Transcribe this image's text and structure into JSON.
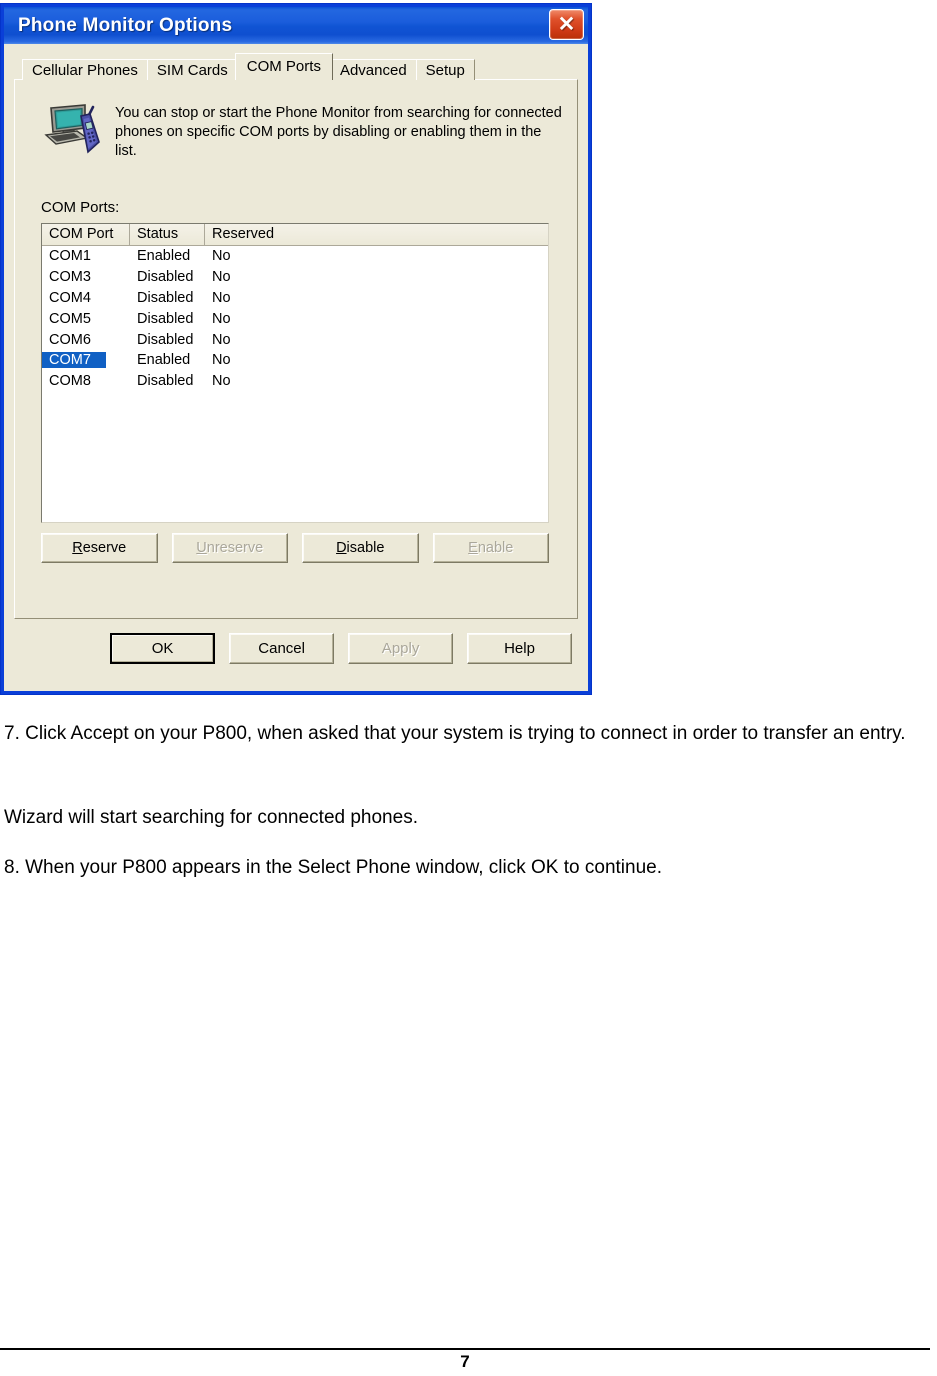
{
  "dialog": {
    "title": "Phone Monitor Options",
    "close_label": "✕",
    "tabs": [
      {
        "label": "Cellular Phones",
        "active": false
      },
      {
        "label": "SIM Cards",
        "active": false
      },
      {
        "label": "COM Ports",
        "active": true
      },
      {
        "label": "Advanced",
        "active": false
      },
      {
        "label": "Setup",
        "active": false
      }
    ],
    "info_text": "You can stop or start the Phone Monitor from searching for connected phones on specific COM ports by disabling or enabling them in the list.",
    "section_label": "COM Ports:",
    "listview": {
      "columns": [
        "COM Port",
        "Status",
        "Reserved"
      ],
      "rows": [
        {
          "port": "COM1",
          "status": "Enabled",
          "reserved": "No",
          "selected": false
        },
        {
          "port": "COM3",
          "status": "Disabled",
          "reserved": "No",
          "selected": false
        },
        {
          "port": "COM4",
          "status": "Disabled",
          "reserved": "No",
          "selected": false
        },
        {
          "port": "COM5",
          "status": "Disabled",
          "reserved": "No",
          "selected": false
        },
        {
          "port": "COM6",
          "status": "Disabled",
          "reserved": "No",
          "selected": false
        },
        {
          "port": "COM7",
          "status": "Enabled",
          "reserved": "No",
          "selected": true
        },
        {
          "port": "COM8",
          "status": "Disabled",
          "reserved": "No",
          "selected": false
        }
      ]
    },
    "action_buttons": [
      {
        "label": "Reserve",
        "accel": "R",
        "enabled": true
      },
      {
        "label": "Unreserve",
        "accel": "U",
        "enabled": false
      },
      {
        "label": "Disable",
        "accel": "D",
        "enabled": true
      },
      {
        "label": "Enable",
        "accel": "E",
        "enabled": false
      }
    ],
    "footer_buttons": [
      {
        "label": "OK",
        "accel": "O",
        "enabled": true,
        "default": true
      },
      {
        "label": "Cancel",
        "accel": "C",
        "enabled": true,
        "default": false
      },
      {
        "label": "Apply",
        "accel": "A",
        "enabled": false,
        "default": false
      },
      {
        "label": "Help",
        "accel": "H",
        "enabled": true,
        "default": false
      }
    ],
    "colors": {
      "titlebar_blue": "#1054d4",
      "frame_blue": "#0a3fd8",
      "face": "#ece9d8",
      "selection_blue": "#1060c4",
      "close_red": "#cf3a16"
    }
  },
  "document": {
    "paragraph_7": "7. Click Accept on your P800, when asked that your system is trying to connect in order to transfer an entry.",
    "paragraph_wizard": "Wizard will start searching for connected phones.",
    "paragraph_8": "8. When your P800 appears in the Select Phone window, click OK to continue.",
    "page_number": "7"
  }
}
